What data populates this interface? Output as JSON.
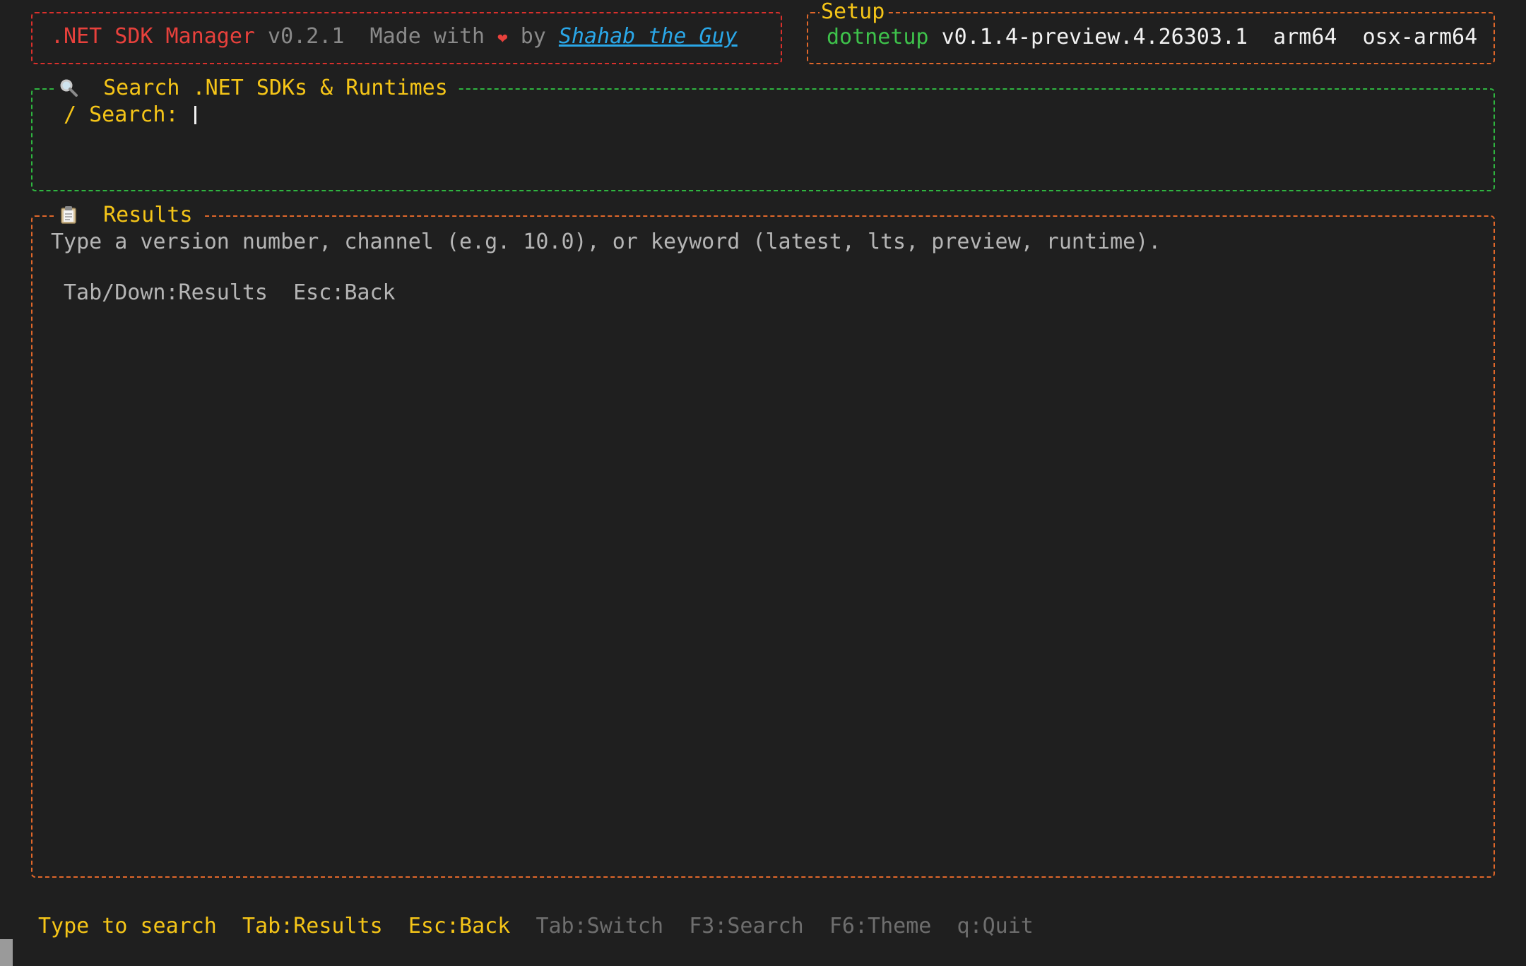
{
  "header": {
    "app_name": ".NET SDK Manager",
    "version": "v0.2.1",
    "made_with": "Made with",
    "heart": "❤",
    "by": "by",
    "author": "Shahab the Guy"
  },
  "setup": {
    "title": "Setup",
    "tool": "dotnetup",
    "tool_version": "v0.1.4-preview.4.26303.1",
    "arch": "arm64",
    "rid": "osx-arm64"
  },
  "search": {
    "title": "Search .NET SDKs & Runtimes",
    "label": "/ Search:",
    "value": ""
  },
  "results": {
    "title": "Results",
    "hint": "Type a version number, channel (e.g. 10.0), or keyword (latest, lts, preview, runtime).",
    "keys": "Tab/Down:Results  Esc:Back"
  },
  "footer": {
    "items": [
      {
        "label": "Type to search",
        "active": true
      },
      {
        "label": "Tab:Results",
        "active": true
      },
      {
        "label": "Esc:Back",
        "active": true
      },
      {
        "label": "Tab:Switch",
        "active": false
      },
      {
        "label": "F3:Search",
        "active": false
      },
      {
        "label": "F6:Theme",
        "active": false
      },
      {
        "label": "q:Quit",
        "active": false
      }
    ]
  },
  "colors": {
    "background": "#1f1f1f",
    "accent_yellow": "#f5c518",
    "red": "#e8413c",
    "green": "#3ec24b",
    "orange": "#e0672a",
    "link": "#2aa7e8"
  },
  "icons": {
    "search": "magnifier-icon",
    "results": "clipboard-icon"
  }
}
